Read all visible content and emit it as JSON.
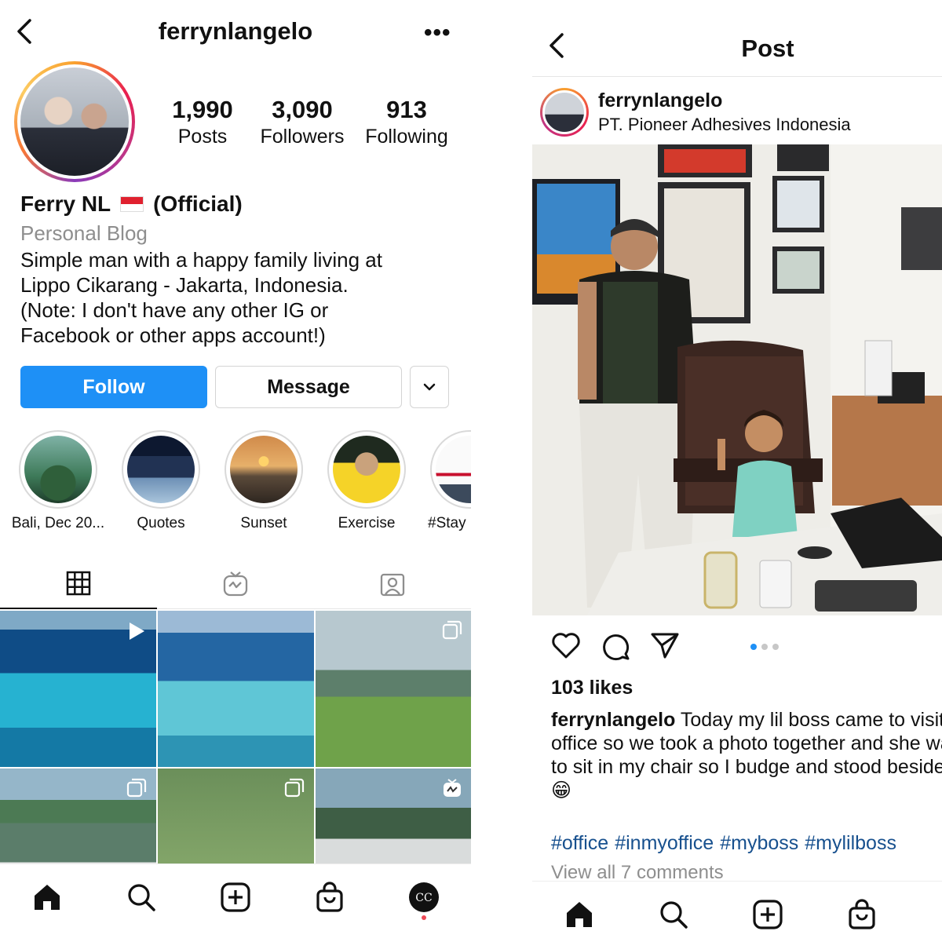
{
  "profile": {
    "username": "ferrynlangelo",
    "more_label": "•••",
    "stats": {
      "posts": {
        "value": "1,990",
        "label": "Posts"
      },
      "followers": {
        "value": "3,090",
        "label": "Followers"
      },
      "following": {
        "value": "913",
        "label": "Following"
      }
    },
    "name": "Ferry NL",
    "name_suffix": "(Official)",
    "category": "Personal Blog",
    "bio": "Simple man with a happy family living at\nLippo Cikarang - Jakarta, Indonesia.\n(Note: I don't have any other IG or\nFacebook or other apps account!)",
    "buttons": {
      "follow": "Follow",
      "message": "Message"
    },
    "highlights": [
      {
        "label": "Bali, Dec 20..."
      },
      {
        "label": "Quotes"
      },
      {
        "label": "Sunset"
      },
      {
        "label": "Exercise"
      },
      {
        "label": "#Stay"
      }
    ],
    "tabs": [
      "grid",
      "igtv",
      "tagged"
    ]
  },
  "post": {
    "header_title": "Post",
    "username": "ferrynlangelo",
    "location": "PT. Pioneer Adhesives Indonesia",
    "likes": "103 likes",
    "caption_user": "ferrynlangelo",
    "caption_text": " Today my lil boss came to visit the office so we took a photo together and she wanted to sit in my chair so I budge and stood beside her 😁",
    "hashtags": [
      "#office",
      "#inmyoffice",
      "#myboss",
      "#mylilboss"
    ],
    "view_comments": "View all 7 comments",
    "carousel": {
      "count": 3,
      "active": 0
    }
  },
  "colors": {
    "accent": "#1e90f6",
    "hashtag": "#17508e",
    "muted": "#8e8e8e",
    "notification": "#ed4956"
  },
  "icons": {
    "profile_nav": [
      "home-icon",
      "search-icon",
      "new-post-icon",
      "shop-icon",
      "profile-avatar-icon"
    ],
    "post_nav": [
      "home-icon",
      "search-icon",
      "new-post-icon",
      "shop-icon"
    ],
    "post_actions": [
      "like-icon",
      "comment-icon",
      "share-icon"
    ]
  }
}
